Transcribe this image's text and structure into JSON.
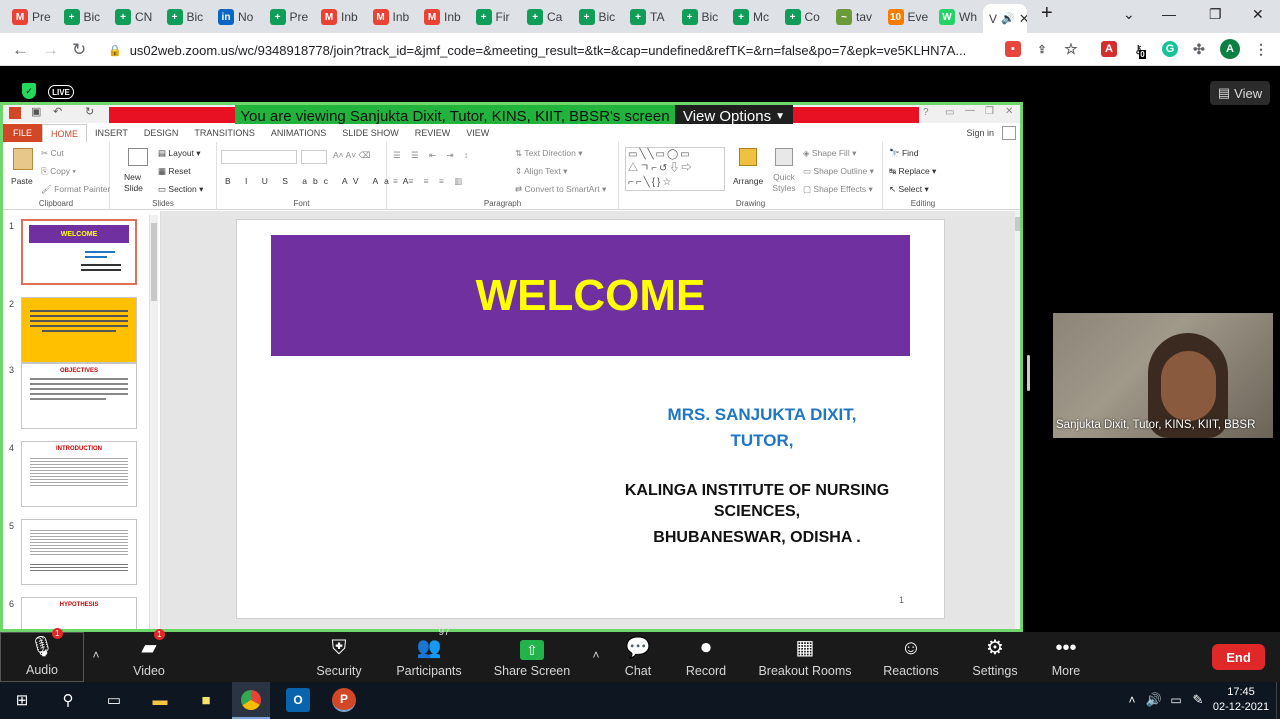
{
  "browser": {
    "tabs": [
      {
        "fav": "M",
        "color": "#ea4335",
        "label": "Pre"
      },
      {
        "fav": "+",
        "color": "#0f9d58",
        "label": "Bic"
      },
      {
        "fav": "+",
        "color": "#0f9d58",
        "label": "CN"
      },
      {
        "fav": "+",
        "color": "#0f9d58",
        "label": "Bic"
      },
      {
        "fav": "in",
        "color": "#0a66c2",
        "label": "No"
      },
      {
        "fav": "+",
        "color": "#0f9d58",
        "label": "Pre"
      },
      {
        "fav": "M",
        "color": "#ea4335",
        "label": "Inb"
      },
      {
        "fav": "M",
        "color": "#ea4335",
        "label": "Inb"
      },
      {
        "fav": "M",
        "color": "#ea4335",
        "label": "Inb"
      },
      {
        "fav": "+",
        "color": "#0f9d58",
        "label": "Fir"
      },
      {
        "fav": "+",
        "color": "#0f9d58",
        "label": "Ca"
      },
      {
        "fav": "+",
        "color": "#0f9d58",
        "label": "Bic"
      },
      {
        "fav": "+",
        "color": "#0f9d58",
        "label": "TA"
      },
      {
        "fav": "+",
        "color": "#0f9d58",
        "label": "Bic"
      },
      {
        "fav": "+",
        "color": "#0f9d58",
        "label": "Mc"
      },
      {
        "fav": "+",
        "color": "#0f9d58",
        "label": "Co"
      },
      {
        "fav": "~",
        "color": "#6a9a3a",
        "label": "tav"
      },
      {
        "fav": "10",
        "color": "#f57c00",
        "label": "Eve"
      },
      {
        "fav": "W",
        "color": "#25d366",
        "label": "Wh"
      }
    ],
    "active_tab": {
      "label": "V",
      "audio_icon": "speaker-icon"
    },
    "url": "us02web.zoom.us/wc/9348918778/join?track_id=&jmf_code=&meeting_result=&tk=&cap=undefined&refTK=&rn=false&po=7&epk=ve5KLHN7A...",
    "profile_initial": "A",
    "ext_badge": "0"
  },
  "zoom": {
    "live_label": "LIVE",
    "view_button": "View",
    "share_banner": "You are viewing Sanjukta Dixit, Tutor, KINS, KIIT, BBSR's screen",
    "view_options": "View Options",
    "participant_video_name": "Sanjukta Dixit, Tutor, KINS, KIIT, BBSR",
    "toolbar": {
      "audio": "Audio",
      "video": "Video",
      "security": "Security",
      "participants": "Participants",
      "participants_count": "97",
      "share": "Share Screen",
      "chat": "Chat",
      "record": "Record",
      "breakout": "Breakout Rooms",
      "reactions": "Reactions",
      "settings": "Settings",
      "more": "More",
      "end": "End",
      "audio_badge": "1",
      "video_badge": "1"
    }
  },
  "ppt": {
    "tabs": [
      "FILE",
      "HOME",
      "INSERT",
      "DESIGN",
      "TRANSITIONS",
      "ANIMATIONS",
      "SLIDE SHOW",
      "REVIEW",
      "VIEW"
    ],
    "sign_in": "Sign in",
    "ribbon": {
      "clipboard": {
        "label": "Clipboard",
        "paste": "Paste",
        "cut": "Cut",
        "copy": "Copy",
        "format_painter": "Format Painter"
      },
      "slides": {
        "label": "Slides",
        "new_slide": "New Slide",
        "layout": "Layout",
        "reset": "Reset",
        "section": "Section"
      },
      "font": {
        "label": "Font"
      },
      "paragraph": {
        "label": "Paragraph",
        "text_direction": "Text Direction",
        "align_text": "Align Text",
        "convert": "Convert to SmartArt"
      },
      "drawing": {
        "label": "Drawing",
        "arrange": "Arrange",
        "quick_styles": "Quick Styles",
        "shape_fill": "Shape Fill",
        "shape_outline": "Shape Outline",
        "shape_effects": "Shape Effects"
      },
      "editing": {
        "label": "Editing",
        "find": "Find",
        "replace": "Replace",
        "select": "Select"
      }
    },
    "thumb_numbers": [
      "1",
      "2",
      "3",
      "4",
      "5",
      "6"
    ],
    "thumb_titles": [
      "WELCOME",
      "",
      "OBJECTIVES",
      "INTRODUCTION",
      "",
      "HYPOTHESIS"
    ],
    "slide": {
      "title": "WELCOME",
      "name_line1": "MRS. SANJUKTA DIXIT,",
      "name_line2": "TUTOR,",
      "inst_line1": "KALINGA INSTITUTE OF NURSING",
      "inst_line2": "SCIENCES,",
      "place": "BHUBANESWAR,  ODISHA .",
      "number": "1"
    }
  },
  "taskbar": {
    "time": "17:45",
    "date": "02-12-2021"
  }
}
